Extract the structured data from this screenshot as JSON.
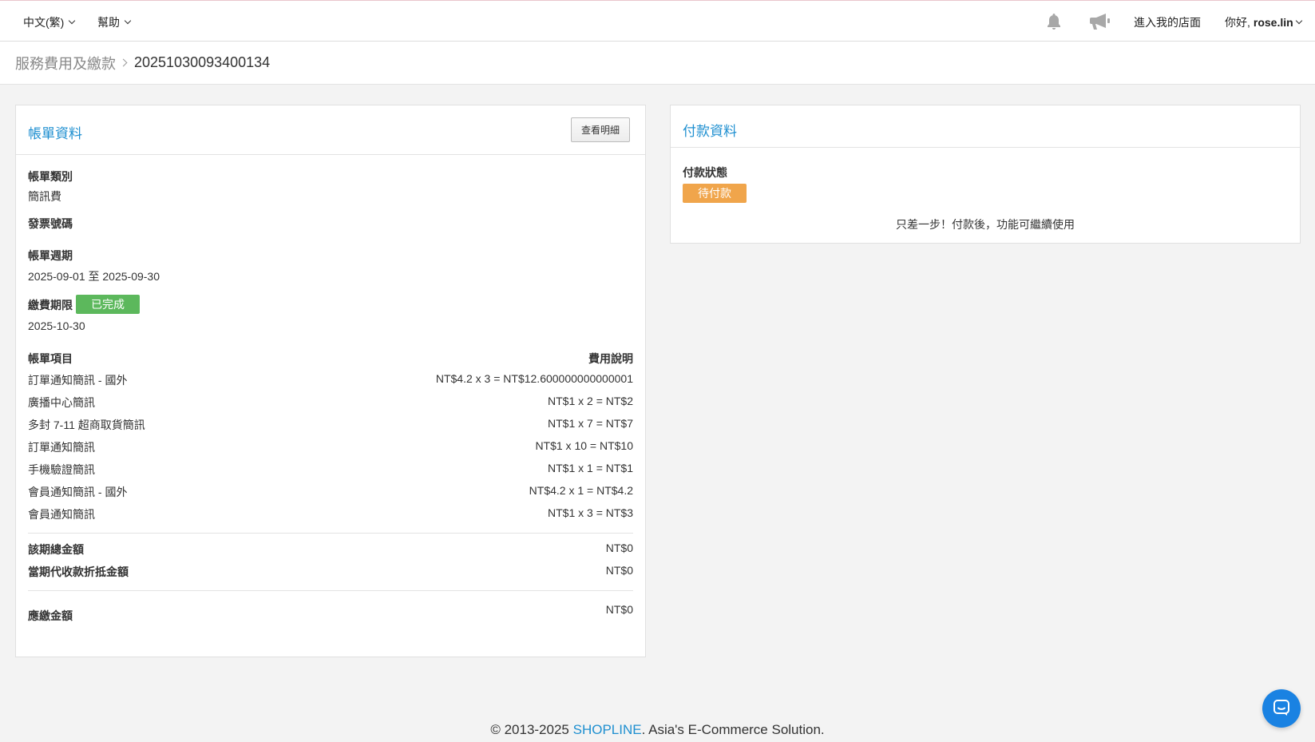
{
  "topbar": {
    "language_label": "中文(繁)",
    "help_label": "幫助",
    "store_link": "進入我的店面",
    "greeting": "你好,",
    "username": "rose.lin",
    "icons": [
      "bell-icon",
      "megaphone-icon",
      "chevron-down-icon"
    ]
  },
  "breadcrumb": {
    "parent": "服務費用及繳款",
    "current": "20251030093400134"
  },
  "bill": {
    "title": "帳單資料",
    "detail_button": "查看明細",
    "type_label": "帳單類別",
    "type_value": "簡訊費",
    "invoice_label": "發票號碼",
    "invoice_value": "",
    "period_label": "帳單週期",
    "period_value": "2025-09-01 至 2025-09-30",
    "due_label": "繳費期限",
    "due_badge": "已完成",
    "due_value": "2025-10-30",
    "items_header_left": "帳單項目",
    "items_header_right": "費用說明",
    "items": [
      {
        "name": "訂單通知簡訊 - 國外",
        "fee": "NT$4.2 x 3 = NT$12.600000000000001"
      },
      {
        "name": "廣播中心簡訊",
        "fee": "NT$1 x 2 = NT$2"
      },
      {
        "name": "多封 7-11 超商取貨簡訊",
        "fee": "NT$1 x 7 = NT$7"
      },
      {
        "name": "訂單通知簡訊",
        "fee": "NT$1 x 10 = NT$10"
      },
      {
        "name": "手機驗證簡訊",
        "fee": "NT$1 x 1 = NT$1"
      },
      {
        "name": "會員通知簡訊 - 國外",
        "fee": "NT$4.2 x 1 = NT$4.2"
      },
      {
        "name": "會員通知簡訊",
        "fee": "NT$1 x 3 = NT$3"
      }
    ],
    "total_label": "該期總金額",
    "total_value": "NT$0",
    "offset_label": "當期代收款折抵金額",
    "offset_value": "NT$0",
    "payable_label": "應繳金額",
    "payable_value": "NT$0"
  },
  "payment": {
    "title": "付款資料",
    "status_label": "付款狀態",
    "status_badge": "待付款",
    "note": "只差一步！付款後，功能可繼續使用"
  },
  "footer": {
    "prefix": "© 2013-2025 ",
    "brand": "SHOPLINE",
    "suffix": ". Asia's E-Commerce Solution."
  },
  "colors": {
    "accent": "#1e8fd0",
    "success": "#5cb85c",
    "warning": "#f0a54b",
    "chat": "#1a82e2"
  }
}
